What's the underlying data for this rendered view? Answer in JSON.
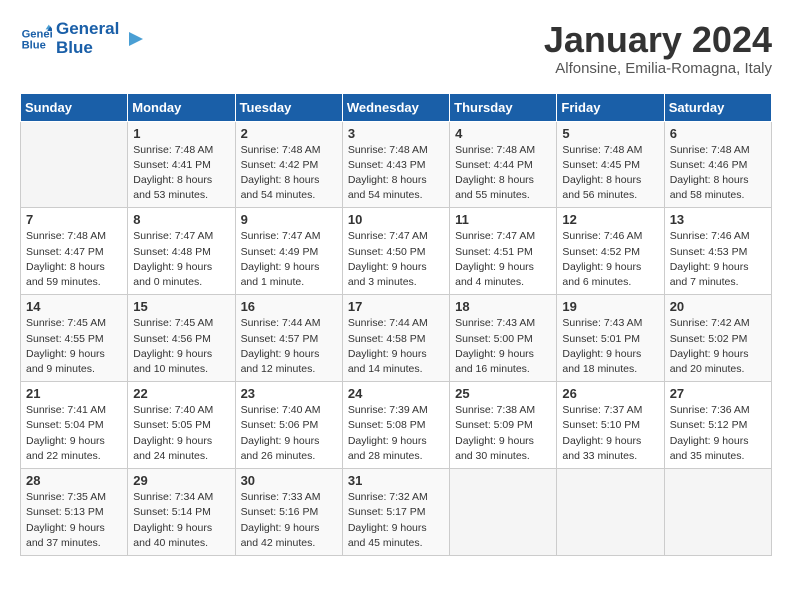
{
  "logo": {
    "line1": "General",
    "line2": "Blue"
  },
  "title": "January 2024",
  "location": "Alfonsine, Emilia-Romagna, Italy",
  "weekdays": [
    "Sunday",
    "Monday",
    "Tuesday",
    "Wednesday",
    "Thursday",
    "Friday",
    "Saturday"
  ],
  "weeks": [
    [
      {
        "day": "",
        "info": ""
      },
      {
        "day": "1",
        "info": "Sunrise: 7:48 AM\nSunset: 4:41 PM\nDaylight: 8 hours\nand 53 minutes."
      },
      {
        "day": "2",
        "info": "Sunrise: 7:48 AM\nSunset: 4:42 PM\nDaylight: 8 hours\nand 54 minutes."
      },
      {
        "day": "3",
        "info": "Sunrise: 7:48 AM\nSunset: 4:43 PM\nDaylight: 8 hours\nand 54 minutes."
      },
      {
        "day": "4",
        "info": "Sunrise: 7:48 AM\nSunset: 4:44 PM\nDaylight: 8 hours\nand 55 minutes."
      },
      {
        "day": "5",
        "info": "Sunrise: 7:48 AM\nSunset: 4:45 PM\nDaylight: 8 hours\nand 56 minutes."
      },
      {
        "day": "6",
        "info": "Sunrise: 7:48 AM\nSunset: 4:46 PM\nDaylight: 8 hours\nand 58 minutes."
      }
    ],
    [
      {
        "day": "7",
        "info": "Sunrise: 7:48 AM\nSunset: 4:47 PM\nDaylight: 8 hours\nand 59 minutes."
      },
      {
        "day": "8",
        "info": "Sunrise: 7:47 AM\nSunset: 4:48 PM\nDaylight: 9 hours\nand 0 minutes."
      },
      {
        "day": "9",
        "info": "Sunrise: 7:47 AM\nSunset: 4:49 PM\nDaylight: 9 hours\nand 1 minute."
      },
      {
        "day": "10",
        "info": "Sunrise: 7:47 AM\nSunset: 4:50 PM\nDaylight: 9 hours\nand 3 minutes."
      },
      {
        "day": "11",
        "info": "Sunrise: 7:47 AM\nSunset: 4:51 PM\nDaylight: 9 hours\nand 4 minutes."
      },
      {
        "day": "12",
        "info": "Sunrise: 7:46 AM\nSunset: 4:52 PM\nDaylight: 9 hours\nand 6 minutes."
      },
      {
        "day": "13",
        "info": "Sunrise: 7:46 AM\nSunset: 4:53 PM\nDaylight: 9 hours\nand 7 minutes."
      }
    ],
    [
      {
        "day": "14",
        "info": "Sunrise: 7:45 AM\nSunset: 4:55 PM\nDaylight: 9 hours\nand 9 minutes."
      },
      {
        "day": "15",
        "info": "Sunrise: 7:45 AM\nSunset: 4:56 PM\nDaylight: 9 hours\nand 10 minutes."
      },
      {
        "day": "16",
        "info": "Sunrise: 7:44 AM\nSunset: 4:57 PM\nDaylight: 9 hours\nand 12 minutes."
      },
      {
        "day": "17",
        "info": "Sunrise: 7:44 AM\nSunset: 4:58 PM\nDaylight: 9 hours\nand 14 minutes."
      },
      {
        "day": "18",
        "info": "Sunrise: 7:43 AM\nSunset: 5:00 PM\nDaylight: 9 hours\nand 16 minutes."
      },
      {
        "day": "19",
        "info": "Sunrise: 7:43 AM\nSunset: 5:01 PM\nDaylight: 9 hours\nand 18 minutes."
      },
      {
        "day": "20",
        "info": "Sunrise: 7:42 AM\nSunset: 5:02 PM\nDaylight: 9 hours\nand 20 minutes."
      }
    ],
    [
      {
        "day": "21",
        "info": "Sunrise: 7:41 AM\nSunset: 5:04 PM\nDaylight: 9 hours\nand 22 minutes."
      },
      {
        "day": "22",
        "info": "Sunrise: 7:40 AM\nSunset: 5:05 PM\nDaylight: 9 hours\nand 24 minutes."
      },
      {
        "day": "23",
        "info": "Sunrise: 7:40 AM\nSunset: 5:06 PM\nDaylight: 9 hours\nand 26 minutes."
      },
      {
        "day": "24",
        "info": "Sunrise: 7:39 AM\nSunset: 5:08 PM\nDaylight: 9 hours\nand 28 minutes."
      },
      {
        "day": "25",
        "info": "Sunrise: 7:38 AM\nSunset: 5:09 PM\nDaylight: 9 hours\nand 30 minutes."
      },
      {
        "day": "26",
        "info": "Sunrise: 7:37 AM\nSunset: 5:10 PM\nDaylight: 9 hours\nand 33 minutes."
      },
      {
        "day": "27",
        "info": "Sunrise: 7:36 AM\nSunset: 5:12 PM\nDaylight: 9 hours\nand 35 minutes."
      }
    ],
    [
      {
        "day": "28",
        "info": "Sunrise: 7:35 AM\nSunset: 5:13 PM\nDaylight: 9 hours\nand 37 minutes."
      },
      {
        "day": "29",
        "info": "Sunrise: 7:34 AM\nSunset: 5:14 PM\nDaylight: 9 hours\nand 40 minutes."
      },
      {
        "day": "30",
        "info": "Sunrise: 7:33 AM\nSunset: 5:16 PM\nDaylight: 9 hours\nand 42 minutes."
      },
      {
        "day": "31",
        "info": "Sunrise: 7:32 AM\nSunset: 5:17 PM\nDaylight: 9 hours\nand 45 minutes."
      },
      {
        "day": "",
        "info": ""
      },
      {
        "day": "",
        "info": ""
      },
      {
        "day": "",
        "info": ""
      }
    ]
  ]
}
